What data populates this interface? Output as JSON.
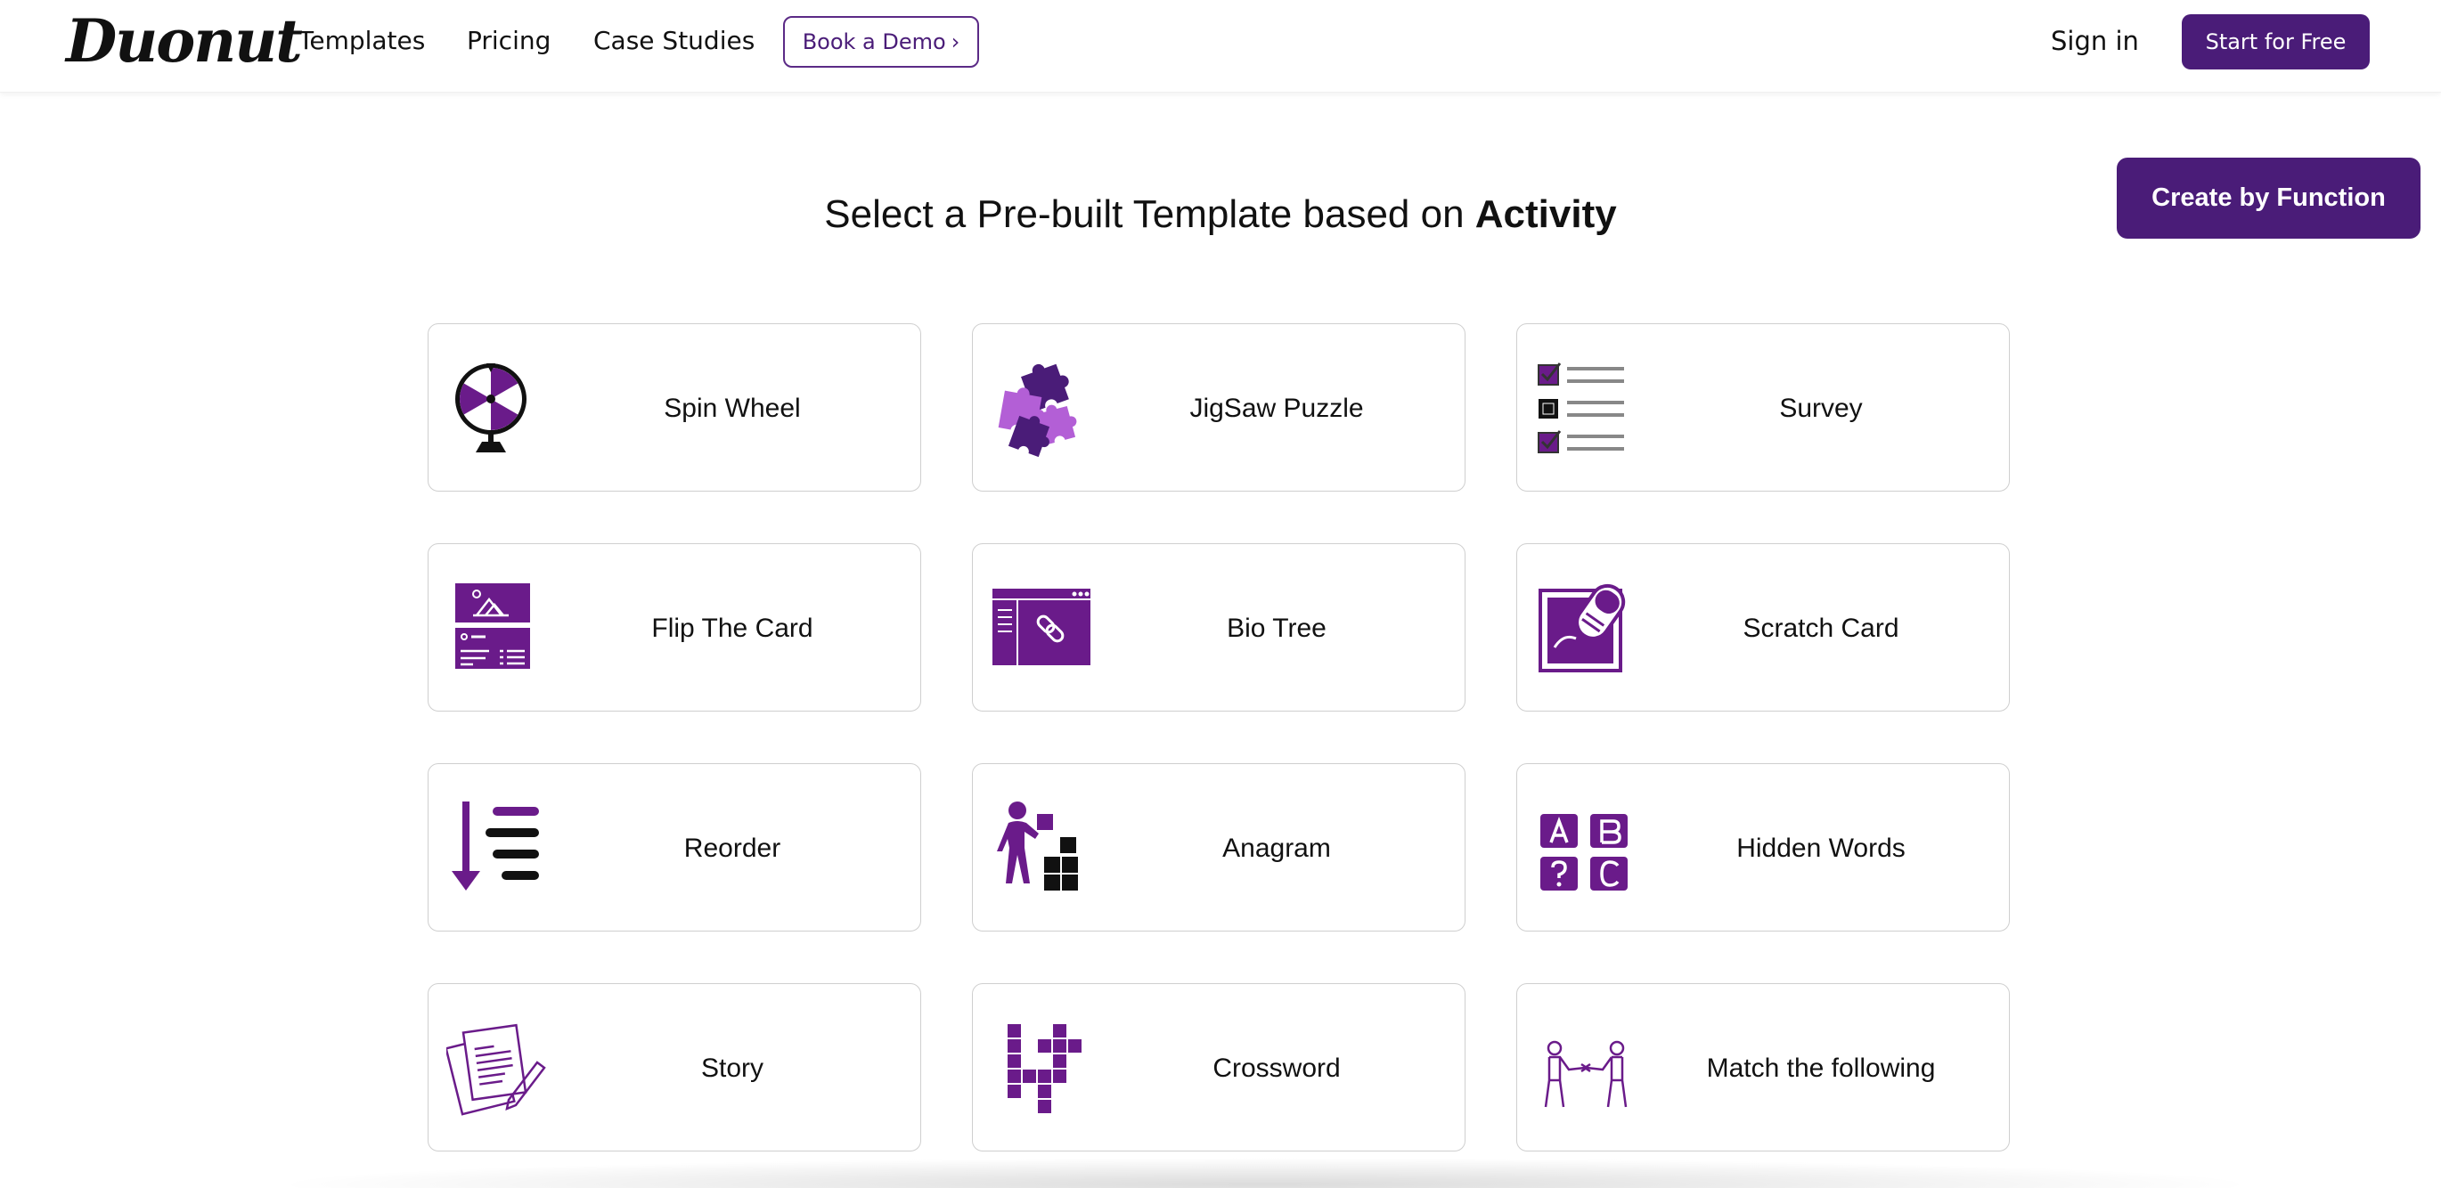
{
  "header": {
    "logo": "Duonut",
    "nav": {
      "templates": "Templates",
      "pricing": "Pricing",
      "case_studies": "Case Studies"
    },
    "demo_label": "Book a Demo",
    "demo_chevron": "›",
    "signin_label": "Sign in",
    "start_label": "Start for Free"
  },
  "function_button": "Create by Function",
  "title": {
    "prefix": "Select a Pre-built Template based on ",
    "emphasis": "Activity"
  },
  "cards": [
    {
      "label": "Spin Wheel",
      "icon": "spin-wheel-icon"
    },
    {
      "label": "JigSaw Puzzle",
      "icon": "jigsaw-puzzle-icon"
    },
    {
      "label": "Survey",
      "icon": "survey-checklist-icon"
    },
    {
      "label": "Flip The Card",
      "icon": "flip-card-icon"
    },
    {
      "label": "Bio Tree",
      "icon": "bio-tree-link-icon"
    },
    {
      "label": "Scratch Card",
      "icon": "scratch-card-icon"
    },
    {
      "label": "Reorder",
      "icon": "reorder-icon"
    },
    {
      "label": "Anagram",
      "icon": "anagram-blocks-icon"
    },
    {
      "label": "Hidden Words",
      "icon": "hidden-words-icon"
    },
    {
      "label": "Story",
      "icon": "story-papers-icon"
    },
    {
      "label": "Crossword",
      "icon": "crossword-icon"
    },
    {
      "label": "Match the following",
      "icon": "match-people-icon"
    }
  ],
  "colors": {
    "brand": "#4a1c78",
    "accent": "#6a1b8a",
    "accent_light": "#b35fd6"
  }
}
